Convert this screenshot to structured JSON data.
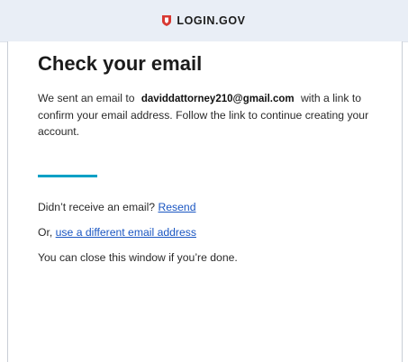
{
  "header": {
    "brand_name": "LOGIN.GOV"
  },
  "main": {
    "title": "Check your email",
    "message_prefix": "We sent an email to",
    "email_address": "daviddattorney210@gmail.com",
    "message_suffix": "with a link to confirm your email address. Follow the link to continue creating your account.",
    "resend_prompt": "Didn’t receive an email?",
    "resend_link": "Resend",
    "alt_prefix": "Or,",
    "alt_link": "use a different email address",
    "close_text": "You can close this window if you’re done."
  },
  "colors": {
    "header_bg": "#e9eef6",
    "accent": "#00a0c6",
    "link": "#1a56c2",
    "brand_shield": "#d83933"
  },
  "icons": {
    "brand": "shield-icon"
  }
}
